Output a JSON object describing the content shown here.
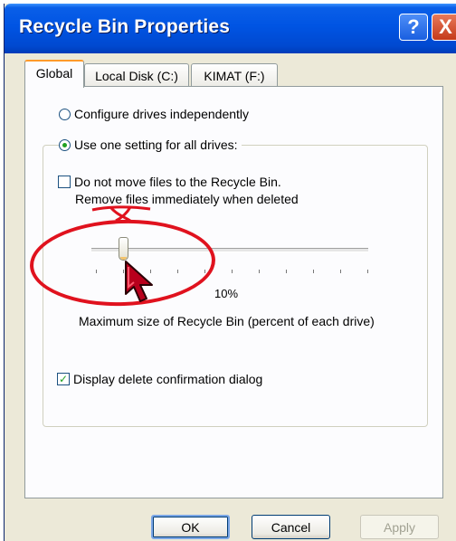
{
  "window": {
    "title": "Recycle Bin Properties",
    "help_glyph": "?",
    "close_glyph": "X"
  },
  "tabs": [
    {
      "label": "Global",
      "active": true
    },
    {
      "label": "Local Disk (C:)",
      "active": false
    },
    {
      "label": "KIMAT (F:)",
      "active": false
    }
  ],
  "options": {
    "configure_independently": {
      "label": "Configure drives independently",
      "selected": false
    },
    "use_one_setting": {
      "label": "Use one setting for all drives:",
      "selected": true
    }
  },
  "do_not_move": {
    "label_line1": "Do not move files to the Recycle Bin.",
    "label_line2": "Remove files immediately when deleted",
    "checked": false
  },
  "max_size": {
    "percent_text": "10%",
    "label": "Maximum size of Recycle Bin (percent of each drive)",
    "value_percent": 10
  },
  "confirm_dialog": {
    "label": "Display delete confirmation dialog",
    "checked": true,
    "check_glyph": "✓"
  },
  "buttons": {
    "ok": "OK",
    "cancel": "Cancel",
    "apply": "Apply"
  },
  "colors": {
    "titlebar": "#0054e3",
    "annotation": "#e0121e",
    "window_bg": "#ece9d8"
  }
}
